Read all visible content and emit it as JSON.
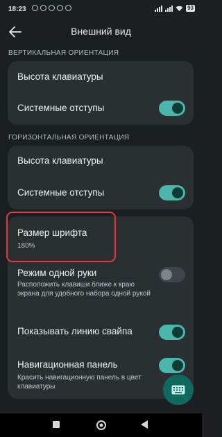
{
  "status_bar": {
    "time": "18:23",
    "battery": "93",
    "icons": [
      "mail-icon",
      "alarm-icon",
      "contact-icon",
      "phone-icon",
      "location-icon",
      "signal-icon",
      "signal-icon",
      "wifi-icon",
      "battery-icon"
    ]
  },
  "app_bar": {
    "title": "Внешний вид"
  },
  "sections": [
    {
      "title": "ВЕРТИКАЛЬНАЯ ОРИЕНТАЦИЯ",
      "items": [
        {
          "label": "Высота клавиатуры"
        },
        {
          "label": "Системные отступы",
          "switch": true
        }
      ]
    },
    {
      "title": "ГОРИЗОНТАЛЬНАЯ ОРИЕНТАЦИЯ",
      "items": [
        {
          "label": "Высота клавиатуры"
        },
        {
          "label": "Системные отступы",
          "switch": true
        }
      ]
    },
    {
      "title": "",
      "items": [
        {
          "label": "Размер шрифта",
          "value": "180%"
        },
        {
          "label": "Режим одной руки",
          "subtitle": "Расположить клавиши ближе к краю экрана для удобного набора одной рукой",
          "switch": false
        },
        {
          "label": "Показывать линию свайпа",
          "switch": true
        },
        {
          "label": "Навигационная панель",
          "subtitle": "Красить навигационную панель в цвет клавиатуры",
          "switch": true
        }
      ]
    }
  ],
  "colors": {
    "background": "#1b1f21",
    "card": "#2a2f32",
    "accent": "#4db6ac",
    "fab": "#11685f",
    "highlight": "#e23a3a"
  },
  "fab": {
    "icon": "keyboard-icon"
  },
  "nav_bar": {
    "icons": [
      "recents-square-icon",
      "home-circle-icon",
      "back-triangle-icon"
    ]
  }
}
